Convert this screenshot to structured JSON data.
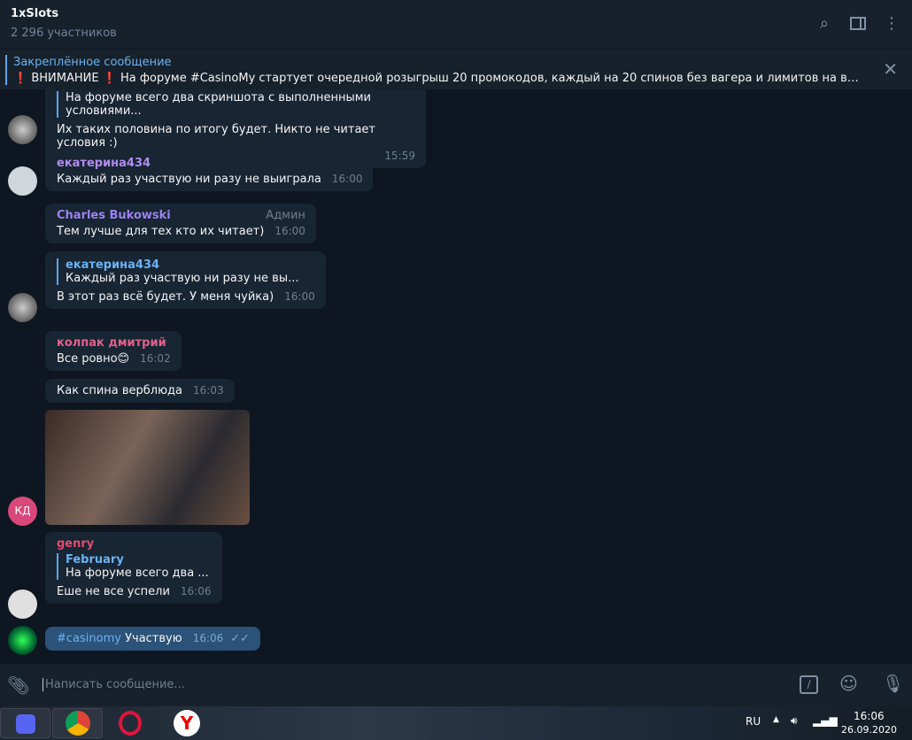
{
  "header": {
    "title": "1xSlots",
    "subtitle": "2 296 участников"
  },
  "pinned": {
    "label": "Закреплённое сообщение",
    "text": "❗ ВНИМАНИЕ ❗  На форуме #CasinoMy стартует очередной розыгрыш 20 промокодов, каждый на 20 спинов без вагера и лимитов на вывод, розыгр..."
  },
  "messages": [
    {
      "reply_text": "На форуме всего два скриншота с выполненными условиями...",
      "text": "Их таких половина по итогу будет. Никто не читает условия :)",
      "time": "15:59"
    },
    {
      "author": "екатерина434",
      "text": "Каждый раз участвую ни разу не выиграла",
      "time": "16:00"
    },
    {
      "author": "Charles Bukowski",
      "badge": "Админ",
      "text": "Тем лучше для тех кто их читает)",
      "time": "16:00"
    },
    {
      "reply_author": "екатерина434",
      "reply_text": "Каждый раз участвую ни разу не вы...",
      "text": "В этот раз всё будет. У меня чуйка)",
      "time": "16:00"
    },
    {
      "author": "колпак дмитрий",
      "text": "Все ровно😊",
      "time": "16:02"
    },
    {
      "text": "Как спина верблюда",
      "time": "16:03"
    },
    {
      "avatar": "КД"
    },
    {
      "author": "genry",
      "reply_author": "February",
      "reply_text": "На форуме всего два ...",
      "text": "Еше не все успели",
      "time": "16:06"
    },
    {
      "hashtag": "#casinomy",
      "text": " Участвую",
      "time": "16:06"
    }
  ],
  "composer": {
    "placeholder": "Написать сообщение..."
  },
  "taskbar": {
    "lang": "RU",
    "time": "16:06",
    "date": "26.09.2020"
  },
  "colors": {
    "bg": "#0e1621",
    "bubble": "#182533",
    "own": "#2b5278"
  }
}
